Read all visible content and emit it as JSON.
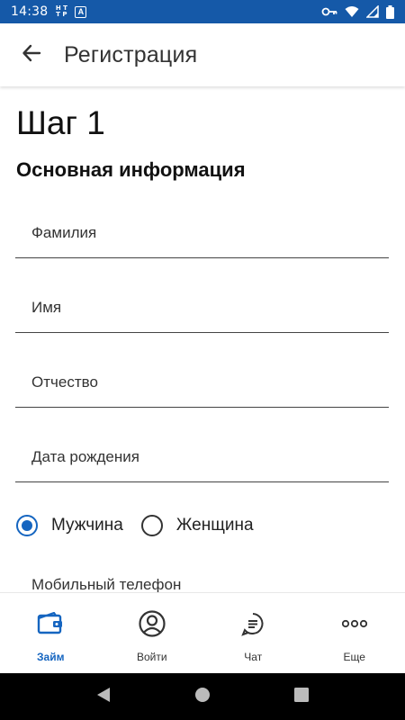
{
  "status_bar": {
    "time": "14:38",
    "notif_icons": [
      "ht-icon",
      "a-icon"
    ],
    "system_icons": [
      "vpn-key-icon",
      "wifi-icon",
      "signal-icon",
      "battery-icon"
    ]
  },
  "app_bar": {
    "title": "Регистрация",
    "back_icon": "arrow-back-icon"
  },
  "form": {
    "step_title": "Шаг 1",
    "section_title": "Основная информация",
    "fields": {
      "last_name": {
        "label": "Фамилия",
        "value": ""
      },
      "first_name": {
        "label": "Имя",
        "value": ""
      },
      "patronymic": {
        "label": "Отчество",
        "value": ""
      },
      "birth_date": {
        "label": "Дата рождения",
        "value": ""
      }
    },
    "gender": {
      "options": [
        "Мужчина",
        "Женщина"
      ],
      "selected": "Мужчина"
    },
    "mobile_phone_label": "Мобильный телефон"
  },
  "bottom_nav": {
    "items": [
      {
        "label": "Займ",
        "icon": "wallet-icon",
        "active": true
      },
      {
        "label": "Войти",
        "icon": "account-icon",
        "active": false
      },
      {
        "label": "Чат",
        "icon": "chat-icon",
        "active": false
      },
      {
        "label": "Еще",
        "icon": "more-icon",
        "active": false
      }
    ]
  },
  "colors": {
    "status_bar": "#1559a8",
    "accent": "#1565c0",
    "text": "#222222"
  }
}
